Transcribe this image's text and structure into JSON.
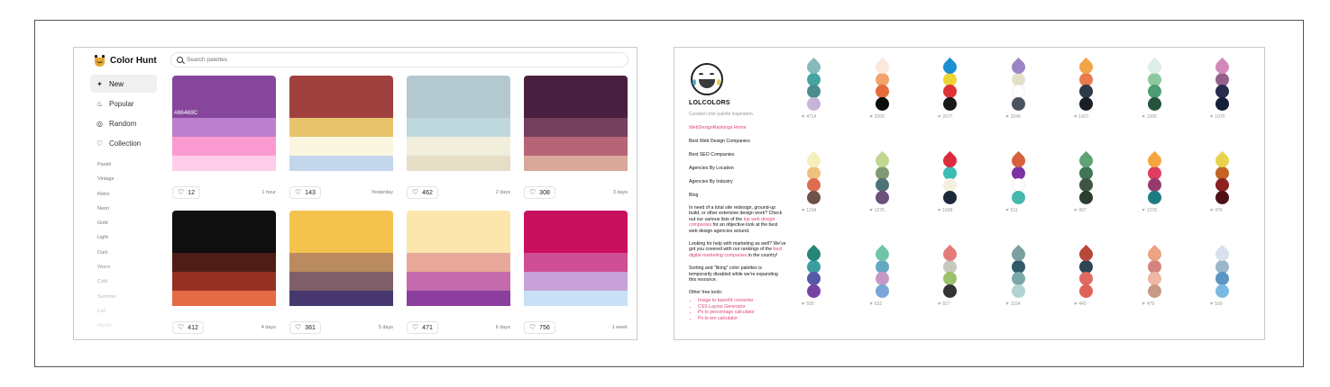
{
  "colorhunt": {
    "brand": "Color Hunt",
    "search_placeholder": "Search palettes",
    "nav": [
      {
        "label": "New",
        "icon": "sparkle-icon",
        "glyph": "✦",
        "active": true
      },
      {
        "label": "Popular",
        "icon": "flame-icon",
        "glyph": "♨",
        "active": false
      },
      {
        "label": "Random",
        "icon": "shuffle-icon",
        "glyph": "◎",
        "active": false
      },
      {
        "label": "Collection",
        "icon": "heart-icon",
        "glyph": "♡",
        "active": false
      }
    ],
    "tags": [
      {
        "label": "Pastel",
        "color": "#777777"
      },
      {
        "label": "Vintage",
        "color": "#777777"
      },
      {
        "label": "Retro",
        "color": "#777777"
      },
      {
        "label": "Neon",
        "color": "#777777"
      },
      {
        "label": "Gold",
        "color": "#777777"
      },
      {
        "label": "Light",
        "color": "#777777"
      },
      {
        "label": "Dark",
        "color": "#888888"
      },
      {
        "label": "Warm",
        "color": "#999999"
      },
      {
        "label": "Cold",
        "color": "#aaaaaa"
      },
      {
        "label": "Summer",
        "color": "#bbbbbb"
      },
      {
        "label": "Fall",
        "color": "#cccccc"
      },
      {
        "label": "Winter",
        "color": "#dddddd"
      }
    ],
    "palettes": [
      {
        "colors": [
          "#86469C",
          "#BC7FCD",
          "#FB9AD1",
          "#FFCDEA"
        ],
        "hex_label": "#86469C",
        "likes": "12",
        "time": "1 hour"
      },
      {
        "colors": [
          "#A0403F",
          "#E7C36C",
          "#FBF6E0",
          "#C3D6EC"
        ],
        "hex_label": "",
        "likes": "143",
        "time": "Yesterday"
      },
      {
        "colors": [
          "#B3C8CF",
          "#BED7DC",
          "#F1EEDC",
          "#E5DDC5"
        ],
        "hex_label": "",
        "likes": "462",
        "time": "2 days"
      },
      {
        "colors": [
          "#4A2040",
          "#73405D",
          "#B56577",
          "#DAA89B"
        ],
        "hex_label": "",
        "likes": "308",
        "time": "3 days"
      },
      {
        "colors": [
          "#0F0F0F",
          "#4F1C16",
          "#953223",
          "#E56B44"
        ],
        "hex_label": "",
        "likes": "412",
        "time": "4 days"
      },
      {
        "colors": [
          "#F4C34E",
          "#BA8B5F",
          "#7F5E6A",
          "#473970"
        ],
        "hex_label": "",
        "likes": "361",
        "time": "5 days"
      },
      {
        "colors": [
          "#FCE6AD",
          "#E8A89A",
          "#C46BAE",
          "#8B3E9E"
        ],
        "hex_label": "",
        "likes": "471",
        "time": "6 days"
      },
      {
        "colors": [
          "#C8105F",
          "#CF4F94",
          "#C7A1D8",
          "#C9E1F6"
        ],
        "hex_label": "",
        "likes": "756",
        "time": "1 week"
      }
    ]
  },
  "lolcolors": {
    "brand": "LOLCOLORS",
    "tagline": "Curated color palette inspiration.",
    "links": [
      {
        "label": "WebDesignRankings Home",
        "pink": true
      },
      {
        "label": "Best Web Design Companies",
        "pink": false
      },
      {
        "label": "Best SEO Companies",
        "pink": false
      },
      {
        "label": "Agencies By Location",
        "pink": false
      },
      {
        "label": "Agencies By Industry",
        "pink": false
      },
      {
        "label": "Blog",
        "pink": false
      }
    ],
    "para1_pre": "In need of a total site redesign, ground-up build, or other extensive design work? Check out our various lists of the",
    "para1_link": "top web design companies",
    "para1_post": "for an objective look at the best web design agencies around.",
    "para2_pre": "Looking for help with marketing as well? We've got you covered with our rankings of the",
    "para2_link": "best digital marketing companies",
    "para2_post": "in the country!",
    "para3": "Sorting and \"liking\" color palettes is temporarily disabled while we're expanding this resource.",
    "tools_heading": "Other free tools:",
    "tools": [
      "Image to base64 converter",
      "CSS Layout Generator",
      "Px to percentage calculator",
      "Px to em calculator"
    ],
    "palettes": [
      {
        "colors": [
          "#86BABD",
          "#46A5A0",
          "#4B8C8C",
          "#C5B4D6"
        ],
        "likes": "4714"
      },
      {
        "colors": [
          "#FCE7DC",
          "#F3A26A",
          "#E46B3A",
          "#0C0C0C"
        ],
        "likes": "2009"
      },
      {
        "colors": [
          "#1C8ED3",
          "#ECD433",
          "#DF3236",
          "#181818"
        ],
        "likes": "2677"
      },
      {
        "colors": [
          "#9C85C4",
          "#E4E1C9",
          "#FFFFFF",
          "#4C5360"
        ],
        "likes": "2046"
      },
      {
        "colors": [
          "#F2A546",
          "#E87A4C",
          "#2D3A47",
          "#1A1F25"
        ],
        "likes": "1427"
      },
      {
        "colors": [
          "#DCEEE6",
          "#8CC79E",
          "#4E9C74",
          "#26533D"
        ],
        "likes": "1365"
      },
      {
        "colors": [
          "#D189B9",
          "#96608C",
          "#272B4E",
          "#15203A"
        ],
        "likes": "1070"
      },
      {
        "colors": [
          "#F4F0B9",
          "#F0C07C",
          "#DE6D50",
          "#6F5247"
        ],
        "likes": "1294"
      },
      {
        "colors": [
          "#BFD88F",
          "#7F9A72",
          "#4D7377",
          "#6B517C"
        ],
        "likes": "1275"
      },
      {
        "colors": [
          "#DC2B3F",
          "#3BBDB4",
          "#F4F0DF",
          "#1B2A3A"
        ],
        "likes": "1658"
      },
      {
        "colors": [
          "#D7603E",
          "#7B33A3",
          "#FFFFFF",
          "#45B8AC"
        ],
        "likes": "511"
      },
      {
        "colors": [
          "#5FA274",
          "#3E7555",
          "#3C5540",
          "#2A3D2E"
        ],
        "likes": "497"
      },
      {
        "colors": [
          "#F5A53E",
          "#DD3D5E",
          "#963A6E",
          "#1E7B82"
        ],
        "likes": "1378"
      },
      {
        "colors": [
          "#E8D24B",
          "#C56324",
          "#8D2020",
          "#4D1016"
        ],
        "likes": "476"
      },
      {
        "colors": [
          "#258577",
          "#3C9DA1",
          "#5659A7",
          "#7643A5"
        ],
        "likes": "595"
      },
      {
        "colors": [
          "#72C4A8",
          "#67A7C4",
          "#C798C6",
          "#7AA6D9"
        ],
        "likes": "632"
      },
      {
        "colors": [
          "#E47A7A",
          "#C6C9BC",
          "#9BC16C",
          "#333333"
        ],
        "likes": "827"
      },
      {
        "colors": [
          "#7D9FA2",
          "#325A6B",
          "#7AA8A8",
          "#B2D3D2"
        ],
        "likes": "1154"
      },
      {
        "colors": [
          "#B84838",
          "#2E4553",
          "#E06A62",
          "#DE6457"
        ],
        "likes": "440"
      },
      {
        "colors": [
          "#EDA283",
          "#D4837C",
          "#EDB7A3",
          "#C89A86"
        ],
        "likes": "479"
      },
      {
        "colors": [
          "#D9E2EC",
          "#9AB7CC",
          "#5D95C2",
          "#7BBAE0"
        ],
        "likes": "509"
      }
    ]
  }
}
